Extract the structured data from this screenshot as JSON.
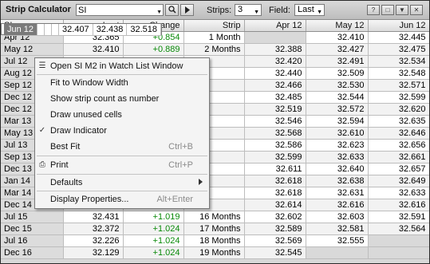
{
  "window": {
    "title": "Strip Calculator",
    "symbol": "SI",
    "strips_label": "Strips:",
    "strips_value": "3",
    "field_label": "Field:",
    "field_value": "Last",
    "search_icon": "magnifier-icon",
    "play_icon": "play-icon"
  },
  "table": {
    "headers": [
      "SI",
      "Last",
      "Change",
      "Strip",
      "Apr 12",
      "May 12",
      "Jun 12"
    ],
    "rows": [
      {
        "name": "Apr 12",
        "last": "32.365",
        "change": "+0.854",
        "strip": "1 Month",
        "apr": "",
        "may": "32.410",
        "jun": "32.445"
      },
      {
        "name": "May 12",
        "last": "32.410",
        "change": "+0.889",
        "strip": "2 Months",
        "apr": "32.388",
        "may": "32.427",
        "jun": "32.475"
      },
      {
        "name": "Jun 12",
        "last": "",
        "change": "",
        "strip": "",
        "apr": "32.407",
        "may": "32.438",
        "jun": "32.518"
      },
      {
        "name": "Jul 12",
        "last": "",
        "change": "",
        "strip": "",
        "apr": "32.420",
        "may": "32.491",
        "jun": "32.534"
      },
      {
        "name": "Aug 12",
        "last": "",
        "change": "",
        "strip": "",
        "apr": "32.440",
        "may": "32.509",
        "jun": "32.548"
      },
      {
        "name": "Sep 12",
        "last": "",
        "change": "",
        "strip": "",
        "apr": "32.466",
        "may": "32.530",
        "jun": "32.571"
      },
      {
        "name": "Dec 12",
        "last": "",
        "change": "",
        "strip": "",
        "apr": "32.485",
        "may": "32.544",
        "jun": "32.599"
      },
      {
        "name": "Dec 12",
        "last": "",
        "change": "",
        "strip": "",
        "apr": "32.519",
        "may": "32.572",
        "jun": "32.620"
      },
      {
        "name": "Mar 13",
        "last": "",
        "change": "",
        "strip": "",
        "apr": "32.546",
        "may": "32.594",
        "jun": "32.635"
      },
      {
        "name": "May 13",
        "last": "",
        "change": "",
        "strip": "",
        "apr": "32.568",
        "may": "32.610",
        "jun": "32.646"
      },
      {
        "name": "Jul 13",
        "last": "",
        "change": "",
        "strip": "",
        "apr": "32.586",
        "may": "32.623",
        "jun": "32.656"
      },
      {
        "name": "Sep 13",
        "last": "",
        "change": "",
        "strip": "",
        "apr": "32.599",
        "may": "32.633",
        "jun": "32.661"
      },
      {
        "name": "Dec 13",
        "last": "",
        "change": "",
        "strip": "",
        "apr": "32.611",
        "may": "32.640",
        "jun": "32.657"
      },
      {
        "name": "Jan 14",
        "last": "",
        "change": "",
        "strip": "",
        "apr": "32.618",
        "may": "32.638",
        "jun": "32.649"
      },
      {
        "name": "Mar 14",
        "last": "",
        "change": "",
        "strip": "",
        "apr": "32.618",
        "may": "32.631",
        "jun": "32.633"
      },
      {
        "name": "Dec 14",
        "last": "",
        "change": "",
        "strip": "",
        "apr": "32.614",
        "may": "32.616",
        "jun": "32.616"
      },
      {
        "name": "Jul 15",
        "last": "32.431",
        "change": "+1.019",
        "strip": "16 Months",
        "apr": "32.602",
        "may": "32.603",
        "jun": "32.591"
      },
      {
        "name": "Dec 15",
        "last": "32.372",
        "change": "+1.024",
        "strip": "17 Months",
        "apr": "32.589",
        "may": "32.581",
        "jun": "32.564"
      },
      {
        "name": "Jul 16",
        "last": "32.226",
        "change": "+1.024",
        "strip": "18 Months",
        "apr": "32.569",
        "may": "32.555",
        "jun": ""
      },
      {
        "name": "Dec 16",
        "last": "32.129",
        "change": "+1.024",
        "strip": "19 Months",
        "apr": "32.545",
        "may": "",
        "jun": ""
      }
    ]
  },
  "menu": {
    "items": [
      {
        "label": "Open SI M2 in Watch List Window",
        "shortcut": "",
        "icon": "watchlist-icon"
      },
      {
        "label": "Fit to Window Width",
        "shortcut": "",
        "icon": ""
      },
      {
        "label": "Show strip count as number",
        "shortcut": "",
        "icon": ""
      },
      {
        "label": "Draw unused cells",
        "shortcut": "",
        "icon": ""
      },
      {
        "label": "Draw Indicator",
        "shortcut": "",
        "icon": "checkmark-icon"
      },
      {
        "label": "Best Fit",
        "shortcut": "Ctrl+B",
        "icon": ""
      },
      {
        "label": "Print",
        "shortcut": "Ctrl+P",
        "icon": "printer-icon"
      },
      {
        "label": "Defaults",
        "shortcut": "",
        "icon": ""
      },
      {
        "label": "Display Properties...",
        "shortcut": "Alt+Enter",
        "icon": ""
      }
    ]
  }
}
